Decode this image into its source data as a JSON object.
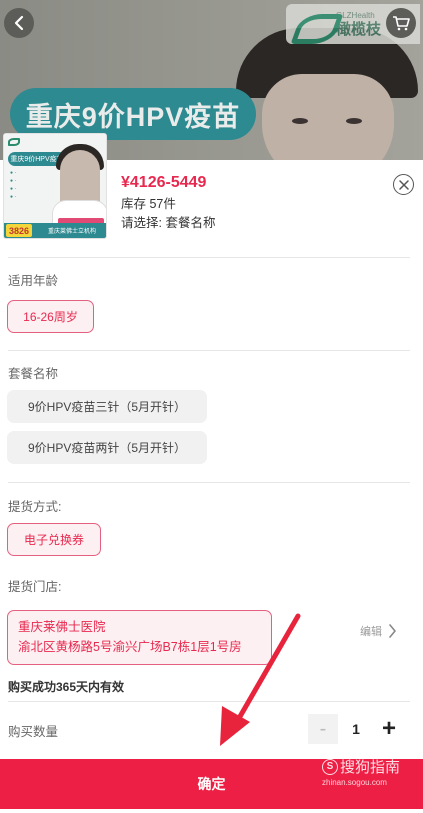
{
  "banner": {
    "title": "重庆9价HPV疫苗",
    "logo_en": "GLZHealth",
    "logo_cn": "橄榄枝"
  },
  "thumbnail": {
    "title": "重庆9价HPV疫苗",
    "price_tag": "3826",
    "store_text": "重庆莱佛士立机构"
  },
  "product": {
    "price": "¥4126-5449",
    "stock": "库存 57件",
    "select_hint": "请选择: 套餐名称"
  },
  "sections": {
    "age": {
      "label": "适用年龄",
      "options": [
        "16-26周岁"
      ]
    },
    "package": {
      "label": "套餐名称",
      "options": [
        "9价HPV疫苗三针（5月开针）",
        "9价HPV疫苗两针（5月开针）"
      ]
    },
    "delivery": {
      "label": "提货方式:",
      "options": [
        "电子兑换券"
      ]
    },
    "store": {
      "label": "提货门店:",
      "name": "重庆莱佛士医院",
      "address": "渝北区黄杨路5号渝兴广场B7栋1层1号房",
      "edit_label": "编辑"
    }
  },
  "validity": "购买成功365天内有效",
  "quantity": {
    "label": "购买数量",
    "value": "1",
    "minus": "-",
    "plus": "+"
  },
  "confirm_label": "确定",
  "watermark": {
    "brand": "搜狗指南",
    "url": "zhinan.sogou.com"
  },
  "colors": {
    "accent": "#e8294f",
    "confirm_bg": "#ee1f44",
    "teal": "#2d8a90"
  }
}
